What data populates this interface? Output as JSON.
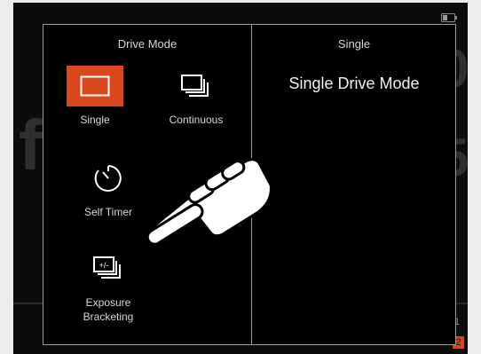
{
  "panel": {
    "left_title": "Drive Mode",
    "right_title": "Single",
    "description": "Single Drive Mode"
  },
  "modes": [
    {
      "label": "Single",
      "icon": "single-frame-icon",
      "selected": true
    },
    {
      "label": "Continuous",
      "icon": "continuous-frames-icon",
      "selected": false
    },
    {
      "label": "Self Timer",
      "icon": "self-timer-icon",
      "selected": false
    },
    {
      "label": "Exposure Bracketing",
      "icon": "exposure-bracketing-icon",
      "selected": false
    }
  ],
  "bracket_icon_text": "+/-",
  "background": {
    "badge_number": "2",
    "top_right_digit": "1"
  },
  "colors": {
    "accent": "#d9471c",
    "panel_bg": "#000000",
    "border": "#9a9a9a",
    "page_bg": "#ececec"
  }
}
